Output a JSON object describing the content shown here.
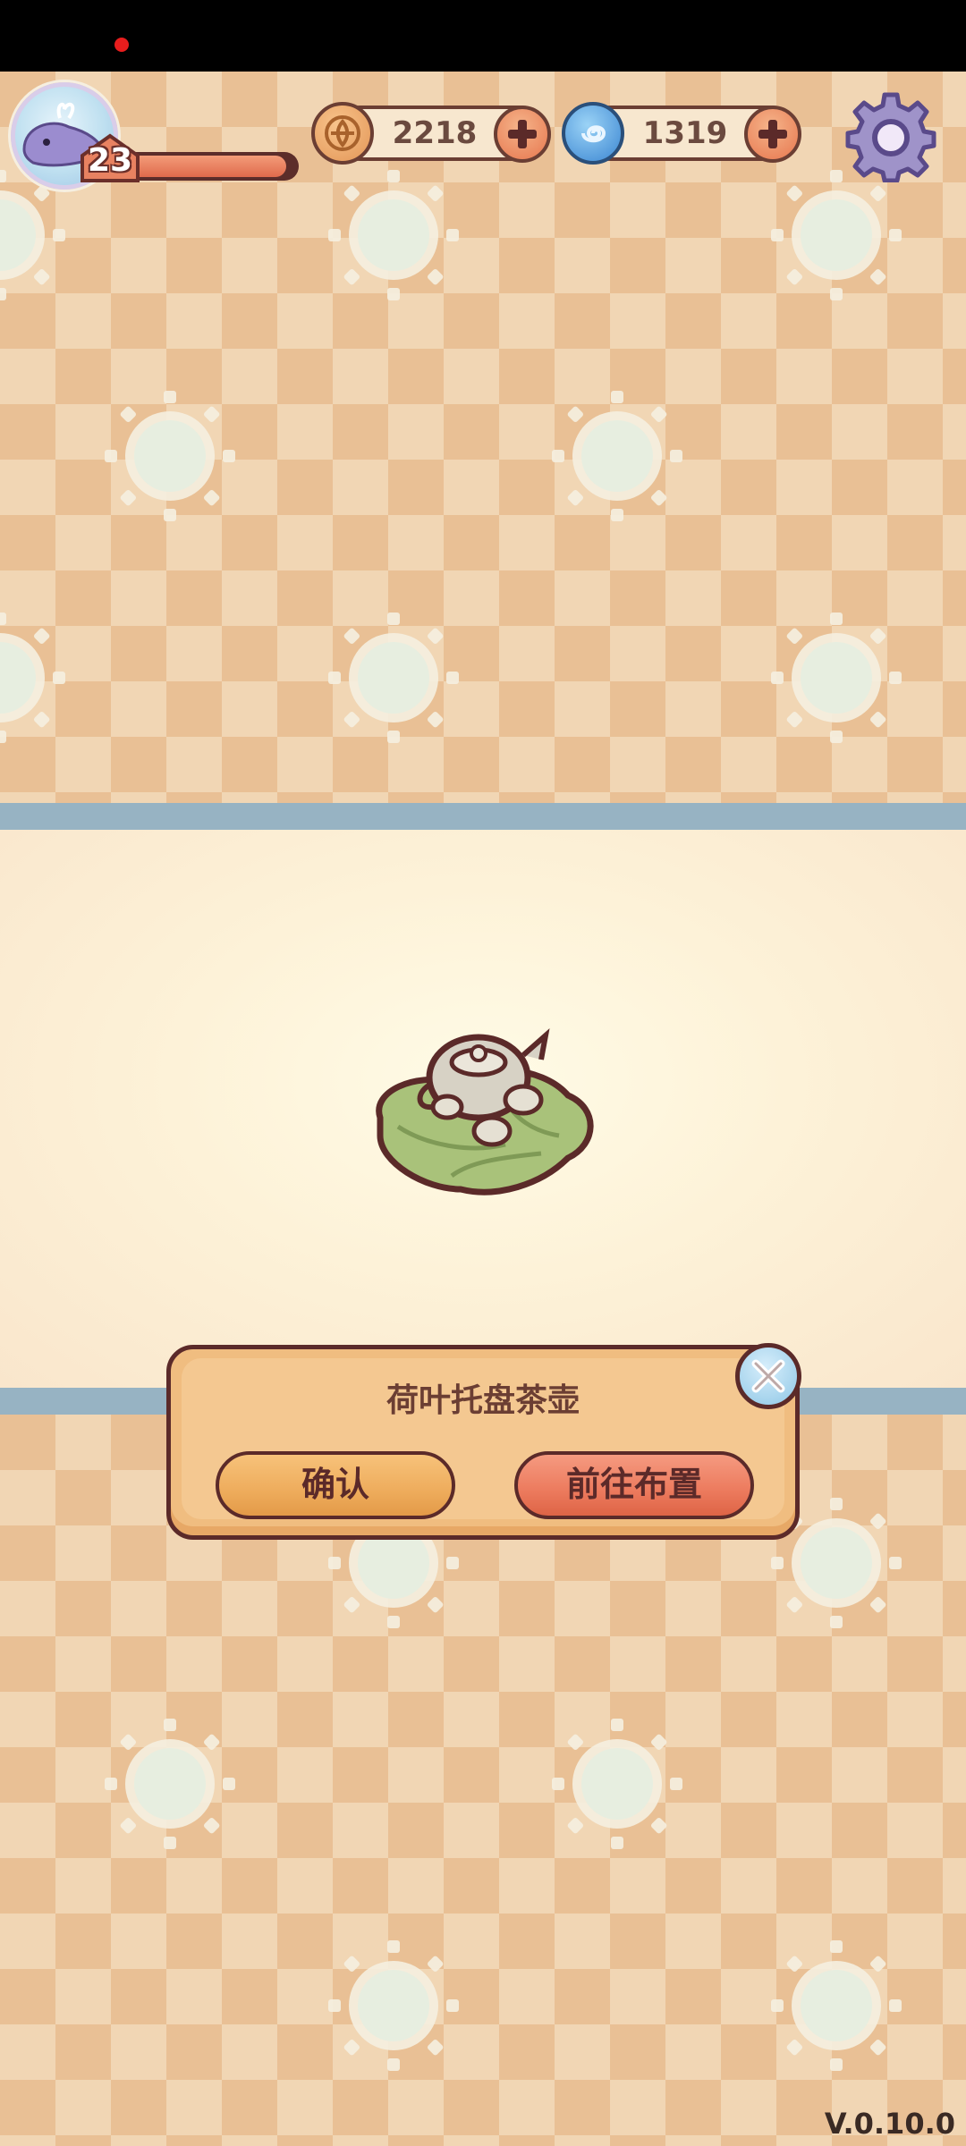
{
  "hud": {
    "level": "23",
    "xp_progress": 0.95,
    "coins": "2218",
    "gems": "1319",
    "icons": {
      "avatar": "whale-avatar-icon",
      "coin": "coin-icon",
      "gem": "swirl-gem-icon",
      "plus": "plus-icon",
      "settings": "gear-icon"
    }
  },
  "item": {
    "name": "荷叶托盘茶壶",
    "icon": "lotus-leaf-teapot-icon"
  },
  "dialog": {
    "confirm_label": "确认",
    "go_place_label": "前往布置",
    "close_icon": "close-icon"
  },
  "footer": {
    "version": "V.0.10.0"
  },
  "colors": {
    "background": "#ebc79c",
    "stripe": "#97b3c3",
    "dialog": "#f0bd80",
    "confirm_button": "#eeac5c",
    "go_button": "#ec7a5d",
    "outline": "#5b2a29"
  }
}
